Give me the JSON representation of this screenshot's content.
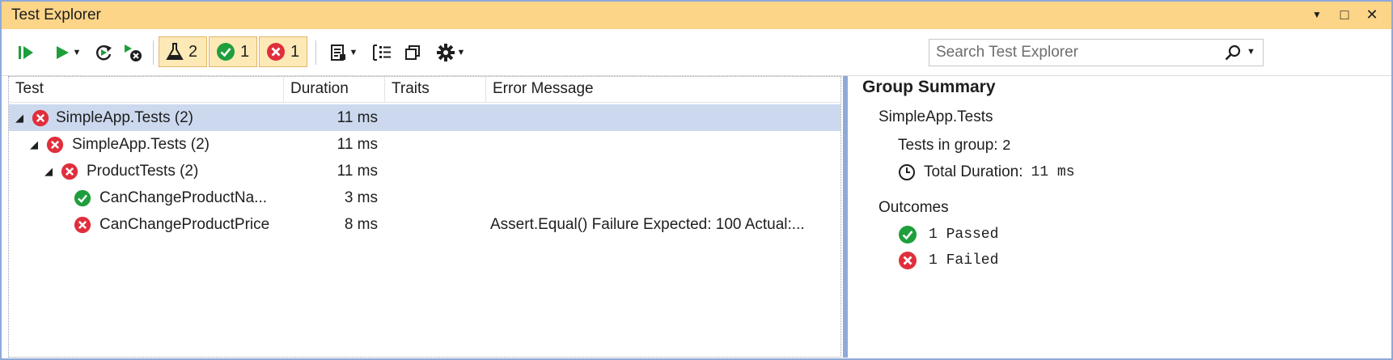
{
  "window": {
    "title": "Test Explorer",
    "controls": {
      "dropdown": "▼",
      "maximize": "□",
      "close": "✕"
    }
  },
  "toolbar": {
    "filters": [
      {
        "icon": "flask-icon",
        "count": "2"
      },
      {
        "icon": "check-icon",
        "count": "1"
      },
      {
        "icon": "error-icon",
        "count": "1"
      }
    ],
    "search": {
      "placeholder": "Search Test Explorer",
      "value": ""
    }
  },
  "grid": {
    "columns": [
      "Test",
      "Duration",
      "Traits",
      "Error Message"
    ],
    "rows": [
      {
        "name": "SimpleApp.Tests  (2)",
        "duration": "11 ms",
        "traits": "",
        "error": "",
        "status": "failed",
        "level": 0,
        "expanded": true,
        "selected": true
      },
      {
        "name": "SimpleApp.Tests  (2)",
        "duration": "11 ms",
        "traits": "",
        "error": "",
        "status": "failed",
        "level": 1,
        "expanded": true,
        "selected": false
      },
      {
        "name": "ProductTests  (2)",
        "duration": "11 ms",
        "traits": "",
        "error": "",
        "status": "failed",
        "level": 2,
        "expanded": true,
        "selected": false
      },
      {
        "name": "CanChangeProductNa...",
        "duration": "3 ms",
        "traits": "",
        "error": "",
        "status": "passed",
        "level": 3,
        "expanded": false,
        "selected": false
      },
      {
        "name": "CanChangeProductPrice",
        "duration": "8 ms",
        "traits": "",
        "error": "Assert.Equal() Failure Expected: 100 Actual:...",
        "status": "failed",
        "level": 3,
        "expanded": false,
        "selected": false
      }
    ]
  },
  "summary": {
    "title": "Group Summary",
    "group_name": "SimpleApp.Tests",
    "tests_in_group_label": "Tests in group:",
    "tests_in_group_value": "2",
    "total_duration_label": "Total Duration:",
    "total_duration_value": "11 ms",
    "outcomes_label": "Outcomes",
    "passed": "1 Passed",
    "failed": "1 Failed"
  },
  "colors": {
    "title_bar": "#fdd588",
    "selection": "#ccd8ee",
    "passed": "#1e9e3c",
    "failed": "#e02f3c",
    "accent_border": "#8fa9d9"
  }
}
